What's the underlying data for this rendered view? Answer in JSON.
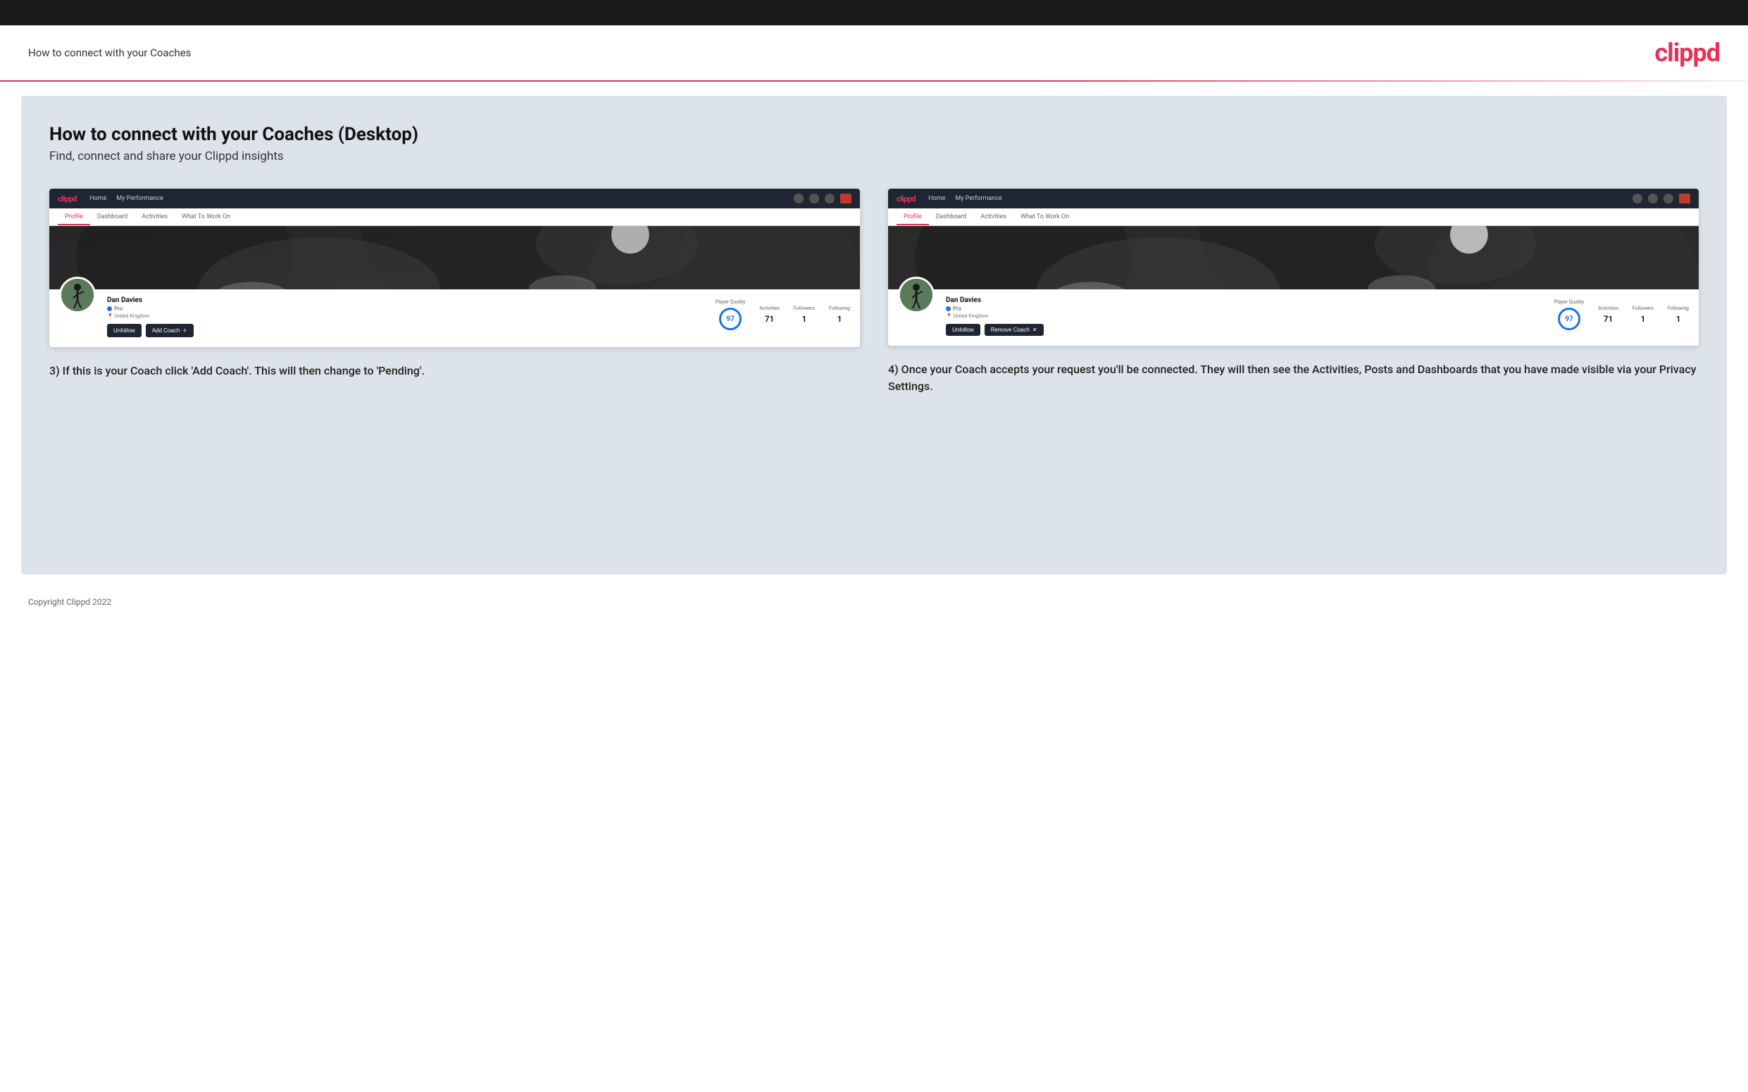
{
  "topbar": {},
  "header": {
    "title": "How to connect with your Coaches",
    "logo": "clippd"
  },
  "main": {
    "title": "How to connect with your Coaches (Desktop)",
    "subtitle": "Find, connect and share your Clippd insights"
  },
  "left_panel": {
    "mock_nav": {
      "logo": "clippd",
      "links": [
        "Home",
        "My Performance"
      ],
      "tabs": [
        "Profile",
        "Dashboard",
        "Activities",
        "What To Work On"
      ],
      "active_tab": "Profile"
    },
    "profile": {
      "name": "Dan Davies",
      "pro": "Pro",
      "location": "United Kingdom",
      "player_quality_label": "Player Quality",
      "player_quality_value": "97",
      "activities_label": "Activities",
      "activities_value": "71",
      "followers_label": "Followers",
      "followers_value": "1",
      "following_label": "Following",
      "following_value": "1"
    },
    "buttons": {
      "unfollow": "Unfollow",
      "add_coach": "Add Coach"
    },
    "description": "3) If this is your Coach click 'Add Coach'. This will then change to 'Pending'."
  },
  "right_panel": {
    "mock_nav": {
      "logo": "clippd",
      "links": [
        "Home",
        "My Performance"
      ],
      "tabs": [
        "Profile",
        "Dashboard",
        "Activities",
        "What To Work On"
      ],
      "active_tab": "Profile"
    },
    "profile": {
      "name": "Dan Davies",
      "pro": "Pro",
      "location": "United Kingdom",
      "player_quality_label": "Player Quality",
      "player_quality_value": "97",
      "activities_label": "Activities",
      "activities_value": "71",
      "followers_label": "Followers",
      "followers_value": "1",
      "following_label": "Following",
      "following_value": "1"
    },
    "buttons": {
      "unfollow": "Unfollow",
      "remove_coach": "Remove Coach"
    },
    "description": "4) Once your Coach accepts your request you'll be connected. They will then see the Activities, Posts and Dashboards that you have made visible via your Privacy Settings."
  },
  "footer": {
    "copyright": "Copyright Clippd 2022"
  }
}
